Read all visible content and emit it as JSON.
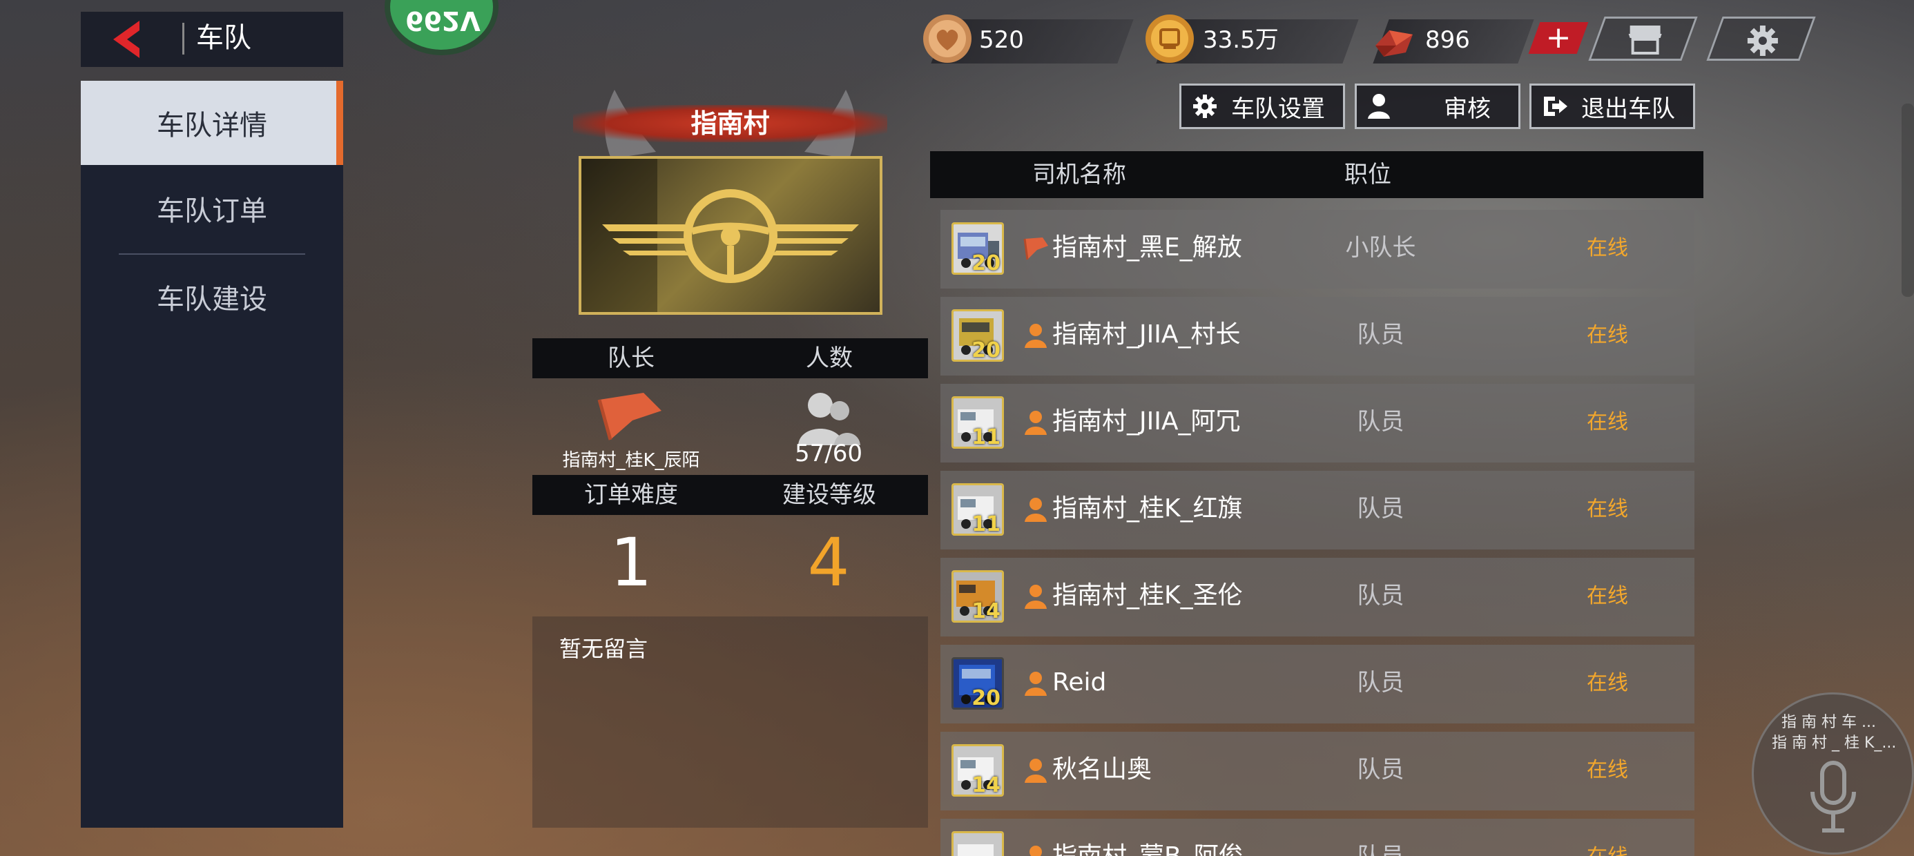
{
  "header": {
    "title": "车队",
    "badge_text": "662V"
  },
  "currency": {
    "hearts": "520",
    "coins": "33.5万",
    "gems": "896",
    "plus_label": "+"
  },
  "sidebar": {
    "items": [
      {
        "label": "车队详情",
        "active": true
      },
      {
        "label": "车队订单",
        "active": false
      },
      {
        "label": "车队建设",
        "active": false
      }
    ]
  },
  "actions": {
    "settings": "车队设置",
    "review": "审核",
    "quit": "退出车队"
  },
  "team": {
    "name": "指南村",
    "leader_header": "队长",
    "count_header": "人数",
    "leader_name": "指南村_桂K_辰陌",
    "member_count": "57/60",
    "difficulty_header": "订单难度",
    "build_level_header": "建设等级",
    "difficulty": "1",
    "build_level": "4",
    "message": "暂无留言"
  },
  "members": {
    "columns": [
      "司机名称",
      "职位"
    ],
    "rows": [
      {
        "name": "指南村_黑E_解放",
        "position": "小队长",
        "status": "在线",
        "level": "20",
        "role": "flag",
        "truck_color": "#6b7fc0"
      },
      {
        "name": "指南村_JIIA_村长",
        "position": "队员",
        "status": "在线",
        "level": "20",
        "role": "person",
        "truck_color": "#c9a93a"
      },
      {
        "name": "指南村_JIIA_阿冗",
        "position": "队员",
        "status": "在线",
        "level": "11",
        "role": "person",
        "truck_color": "#d0d0d0"
      },
      {
        "name": "指南村_桂K_红旗",
        "position": "队员",
        "status": "在线",
        "level": "11",
        "role": "person",
        "truck_color": "#d6d6d6"
      },
      {
        "name": "指南村_桂K_圣伦",
        "position": "队员",
        "status": "在线",
        "level": "14",
        "role": "person",
        "truck_color": "#d48a2a"
      },
      {
        "name": "Reid",
        "position": "队员",
        "status": "在线",
        "level": "20",
        "role": "person",
        "truck_color": "#2a5cc8"
      },
      {
        "name": "秋名山奥",
        "position": "队员",
        "status": "在线",
        "level": "14",
        "role": "person",
        "truck_color": "#e0e0e0"
      },
      {
        "name": "指南村_蒙B_阿俊",
        "position": "队员",
        "status": "在线",
        "level": "",
        "role": "person",
        "truck_color": "#dddddd"
      }
    ]
  },
  "voice": {
    "line1": "指 南 村 车 ...",
    "line2": "指 南 村 _ 桂 K_..."
  }
}
